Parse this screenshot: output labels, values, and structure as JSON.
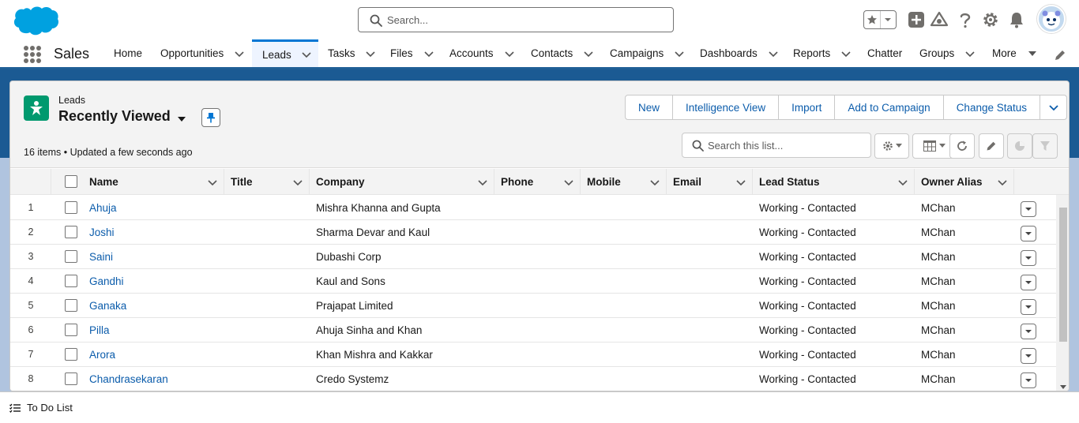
{
  "header": {
    "search_placeholder": "Search..."
  },
  "nav": {
    "app_name": "Sales",
    "items": [
      {
        "label": "Home",
        "has_menu": false
      },
      {
        "label": "Opportunities",
        "has_menu": true
      },
      {
        "label": "Leads",
        "has_menu": true,
        "active": true
      },
      {
        "label": "Tasks",
        "has_menu": true
      },
      {
        "label": "Files",
        "has_menu": true
      },
      {
        "label": "Accounts",
        "has_menu": true
      },
      {
        "label": "Contacts",
        "has_menu": true
      },
      {
        "label": "Campaigns",
        "has_menu": true
      },
      {
        "label": "Dashboards",
        "has_menu": true
      },
      {
        "label": "Reports",
        "has_menu": true
      },
      {
        "label": "Chatter",
        "has_menu": false
      },
      {
        "label": "Groups",
        "has_menu": true
      },
      {
        "label": "More",
        "has_menu": true
      }
    ]
  },
  "list": {
    "object_label": "Leads",
    "view_name": "Recently Viewed",
    "info": "16 items • Updated a few seconds ago",
    "search_placeholder": "Search this list...",
    "actions": [
      "New",
      "Intelligence View",
      "Import",
      "Add to Campaign",
      "Change Status"
    ],
    "columns": [
      "Name",
      "Title",
      "Company",
      "Phone",
      "Mobile",
      "Email",
      "Lead Status",
      "Owner Alias"
    ],
    "rows": [
      {
        "num": "1",
        "name": "Ahuja",
        "title": "",
        "company": "Mishra Khanna and Gupta",
        "phone": "",
        "mobile": "",
        "email": "",
        "status": "Working - Contacted",
        "owner": "MChan"
      },
      {
        "num": "2",
        "name": "Joshi",
        "title": "",
        "company": "Sharma Devar and Kaul",
        "phone": "",
        "mobile": "",
        "email": "",
        "status": "Working - Contacted",
        "owner": "MChan"
      },
      {
        "num": "3",
        "name": "Saini",
        "title": "",
        "company": "Dubashi Corp",
        "phone": "",
        "mobile": "",
        "email": "",
        "status": "Working - Contacted",
        "owner": "MChan"
      },
      {
        "num": "4",
        "name": "Gandhi",
        "title": "",
        "company": "Kaul and Sons",
        "phone": "",
        "mobile": "",
        "email": "",
        "status": "Working - Contacted",
        "owner": "MChan"
      },
      {
        "num": "5",
        "name": "Ganaka",
        "title": "",
        "company": "Prajapat Limited",
        "phone": "",
        "mobile": "",
        "email": "",
        "status": "Working - Contacted",
        "owner": "MChan"
      },
      {
        "num": "6",
        "name": "Pilla",
        "title": "",
        "company": "Ahuja Sinha and Khan",
        "phone": "",
        "mobile": "",
        "email": "",
        "status": "Working - Contacted",
        "owner": "MChan"
      },
      {
        "num": "7",
        "name": "Arora",
        "title": "",
        "company": "Khan Mishra and Kakkar",
        "phone": "",
        "mobile": "",
        "email": "",
        "status": "Working - Contacted",
        "owner": "MChan"
      },
      {
        "num": "8",
        "name": "Chandrasekaran",
        "title": "",
        "company": "Credo Systemz",
        "phone": "",
        "mobile": "",
        "email": "",
        "status": "Working - Contacted",
        "owner": "MChan"
      }
    ]
  },
  "utility": {
    "todo_label": "To Do List"
  },
  "colors": {
    "brand_blue": "#0176d3",
    "link_blue": "#0b5cab",
    "lead_icon_green": "#00996e",
    "nav_underline": "#1f5f96"
  }
}
